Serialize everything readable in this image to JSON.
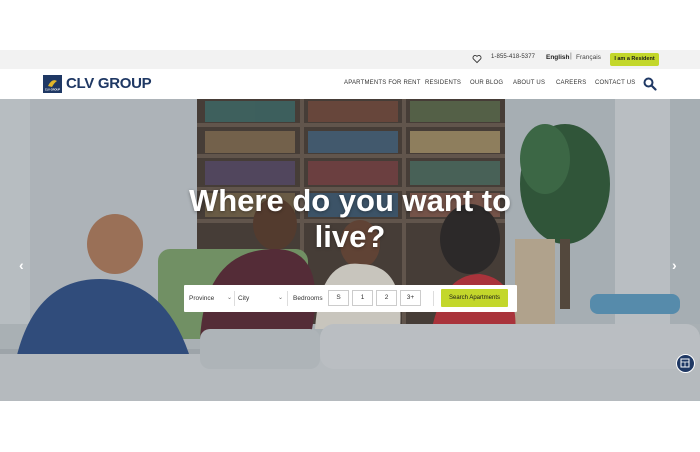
{
  "utility": {
    "phone": "1-855-418-5377",
    "lang_en": "English",
    "lang_separator": "|",
    "lang_fr": "Français",
    "resident_button": "I am a Resident"
  },
  "header": {
    "logo_badge": "CLV GROUP",
    "logo_text": "CLV GROUP",
    "nav": [
      {
        "label": "APARTMENTS FOR RENT"
      },
      {
        "label": "RESIDENTS"
      },
      {
        "label": "OUR BLOG"
      },
      {
        "label": "ABOUT US"
      },
      {
        "label": "CAREERS"
      },
      {
        "label": "CONTACT US"
      }
    ]
  },
  "hero": {
    "title_line1": "Where do you want to",
    "title_line2": "live?",
    "prev_arrow": "‹",
    "next_arrow": "›"
  },
  "search": {
    "province": "Province",
    "city": "City",
    "bedrooms_label": "Bedrooms",
    "bedroom_options": [
      "S",
      "1",
      "2",
      "3+"
    ],
    "submit": "Search Apartments"
  },
  "colors": {
    "brand_navy": "#1f3864",
    "accent_green": "#c3d72b",
    "utility_bg": "#f2f2f2"
  },
  "icons": {
    "favorites": "heart-icon",
    "search": "search-icon",
    "accessibility": "accessibility-icon"
  }
}
